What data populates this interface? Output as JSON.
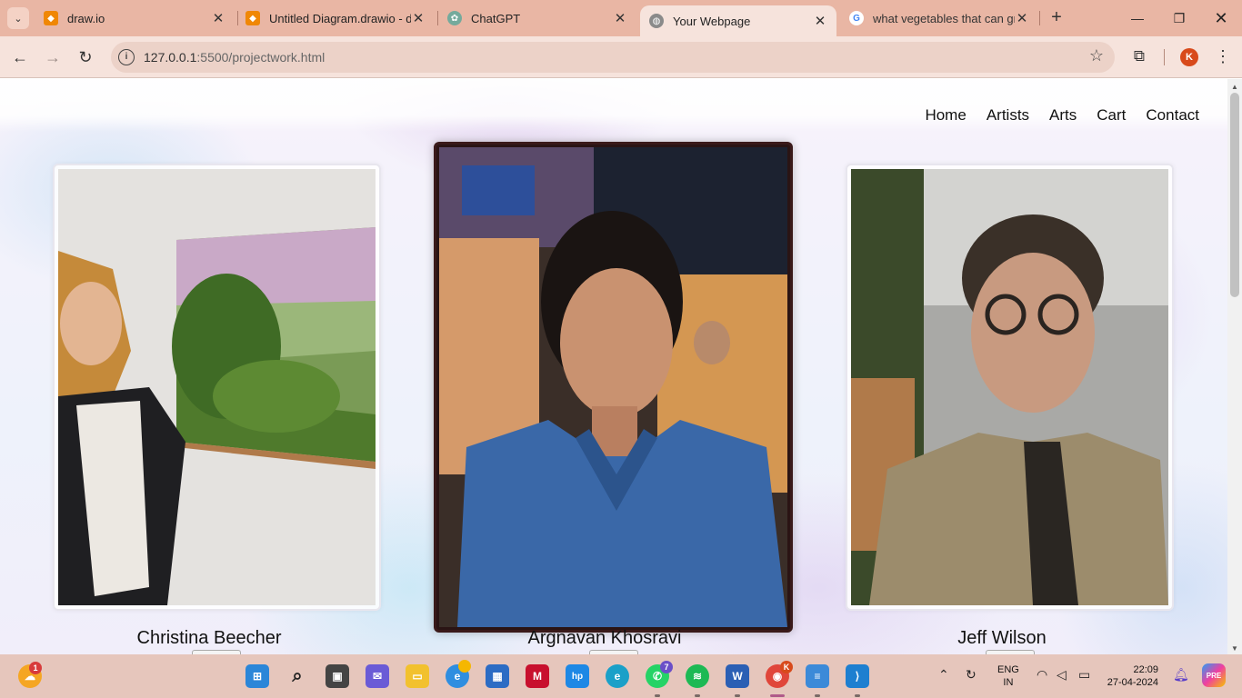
{
  "browser": {
    "tabs": [
      {
        "title": "draw.io",
        "icon": "drawio-icon",
        "active": false
      },
      {
        "title": "Untitled Diagram.drawio - d",
        "icon": "drawio-icon",
        "active": false
      },
      {
        "title": "ChatGPT",
        "icon": "chatgpt-icon",
        "active": false
      },
      {
        "title": "Your Webpage",
        "icon": "globe-icon",
        "active": true
      },
      {
        "title": "what vegetables that can gr",
        "icon": "google-icon",
        "active": false
      }
    ],
    "url_host": "127.0.0.1",
    "url_rest": ":5500/projectwork.html",
    "profile_initial": "K"
  },
  "page": {
    "nav": [
      "Home",
      "Artists",
      "Arts",
      "Cart",
      "Contact"
    ],
    "artists": [
      {
        "name": "Christina Beecher"
      },
      {
        "name": "Argnavan Khosravi"
      },
      {
        "name": "Jeff Wilson"
      }
    ]
  },
  "taskbar": {
    "weather_badge": "1",
    "whatsapp_badge": "7",
    "chrome_badge": "K",
    "lang_line1": "ENG",
    "lang_line2": "IN",
    "time": "22:09",
    "date": "27-04-2024",
    "copilot_label": "PRE"
  },
  "colors": {
    "tabstrip": "#e9b6a4",
    "toolbar": "#f6e3dc",
    "taskbar": "#e6c6bc"
  }
}
